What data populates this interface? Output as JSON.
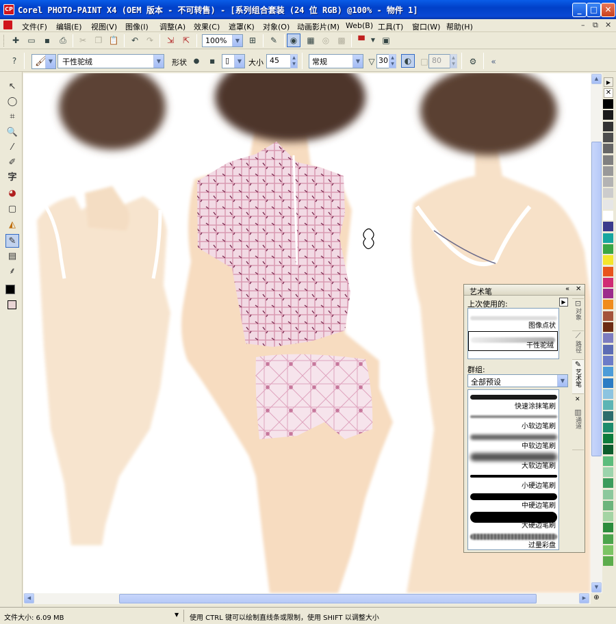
{
  "window": {
    "title": "Corel PHOTO-PAINT X4 (OEM 版本 - 不可转售) - [系列组合套装 (24 位 RGB) @100% - 物件 1]",
    "app_icon_text": "CP"
  },
  "menu": [
    "文件(F)",
    "编辑(E)",
    "视图(V)",
    "图像(I)",
    "调整(A)",
    "效果(C)",
    "遮罩(K)",
    "对象(O)",
    "动画影片(M)",
    "Web(B)",
    "工具(T)",
    "窗口(W)",
    "帮助(H)"
  ],
  "toolbar": {
    "zoom": "100%"
  },
  "property_bar": {
    "brush_name": "干性驼绒",
    "shape_label": "形状",
    "size_label": "大小",
    "size_value": "45",
    "mode": "常规",
    "transparency_value": "30",
    "disabled_value": "80"
  },
  "docker": {
    "title": "艺术笔",
    "recent_label": "上次使用的:",
    "recent": [
      "图像点状",
      "干性驼绒"
    ],
    "group_label": "群组:",
    "group_value": "全部预设",
    "presets": [
      "快速涂抹笔刷",
      "小软边笔刷",
      "中软边笔刷",
      "大软边笔刷",
      "小硬边笔刷",
      "中硬边笔刷",
      "大硬边笔刷",
      "过量彩盘"
    ],
    "tabs": [
      "对象",
      "路径",
      "艺术笔",
      "通道"
    ]
  },
  "status": {
    "file_size": "文件大小: 6.09 MB",
    "hint": "使用 CTRL 键可以绘制直线条或限制，使用 SHIFT 以调整大小"
  },
  "colors": {
    "accent": "#0a48d4",
    "swatches": [
      "#000000",
      "#1a1a1a",
      "#333333",
      "#4d4d4d",
      "#666666",
      "#808080",
      "#999999",
      "#b3b3b3",
      "#cccccc",
      "#e6e6e6",
      "#ffffff",
      "#3a3a8c",
      "#17a6a0",
      "#3aa644",
      "#f4e52c",
      "#e8541c",
      "#d02c74",
      "#9c2c8c",
      "#f08c1c",
      "#a4543c",
      "#6c2c14",
      "#7c7cc0",
      "#5c6cb4",
      "#6c7cc8",
      "#4c9cd8",
      "#2c7cc4",
      "#8cc4e0",
      "#5cb4b4",
      "#2c6c6c",
      "#1c8c6c",
      "#0c7c3c",
      "#0c5c2c",
      "#5cbc7c",
      "#9cd4ac",
      "#3c9c5c",
      "#8cc89c",
      "#6cb47c",
      "#a4d4a4",
      "#2c8c3c",
      "#4ca44c",
      "#7cc464",
      "#5cac4c"
    ]
  }
}
